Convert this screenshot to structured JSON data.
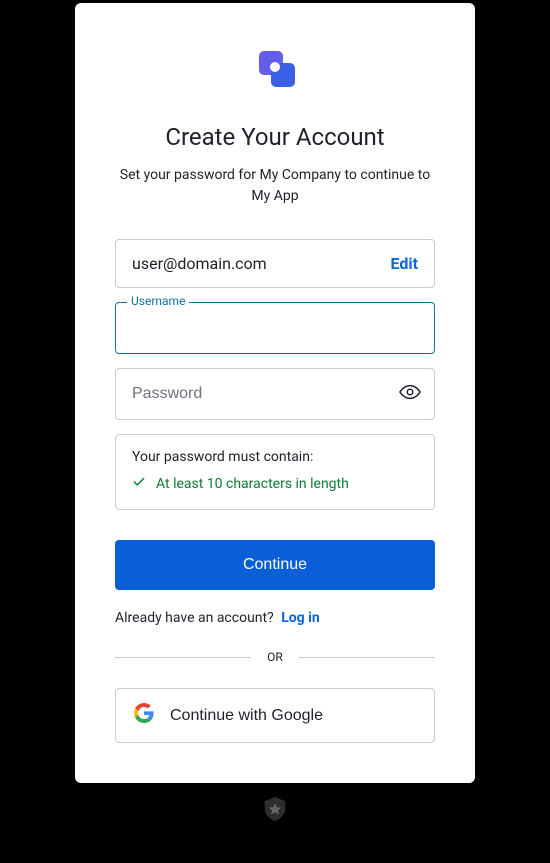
{
  "header": {
    "title": "Create Your Account",
    "subtitle": "Set your password for My Company to continue to My App"
  },
  "email": {
    "value": "user@domain.com",
    "edit_label": "Edit"
  },
  "username": {
    "label": "Username",
    "value": ""
  },
  "password": {
    "placeholder": "Password",
    "value": ""
  },
  "rules": {
    "title": "Your password must contain:",
    "items": [
      {
        "text": "At least 10 characters in length",
        "met": true
      }
    ]
  },
  "actions": {
    "continue": "Continue",
    "already": "Already have an account?",
    "login": "Log in",
    "or": "OR",
    "google": "Continue with Google"
  },
  "colors": {
    "primary": "#0a5ed7",
    "link": "#0a66db",
    "focus": "#1271a6",
    "success": "#0f7a37",
    "border": "#c9cace"
  }
}
